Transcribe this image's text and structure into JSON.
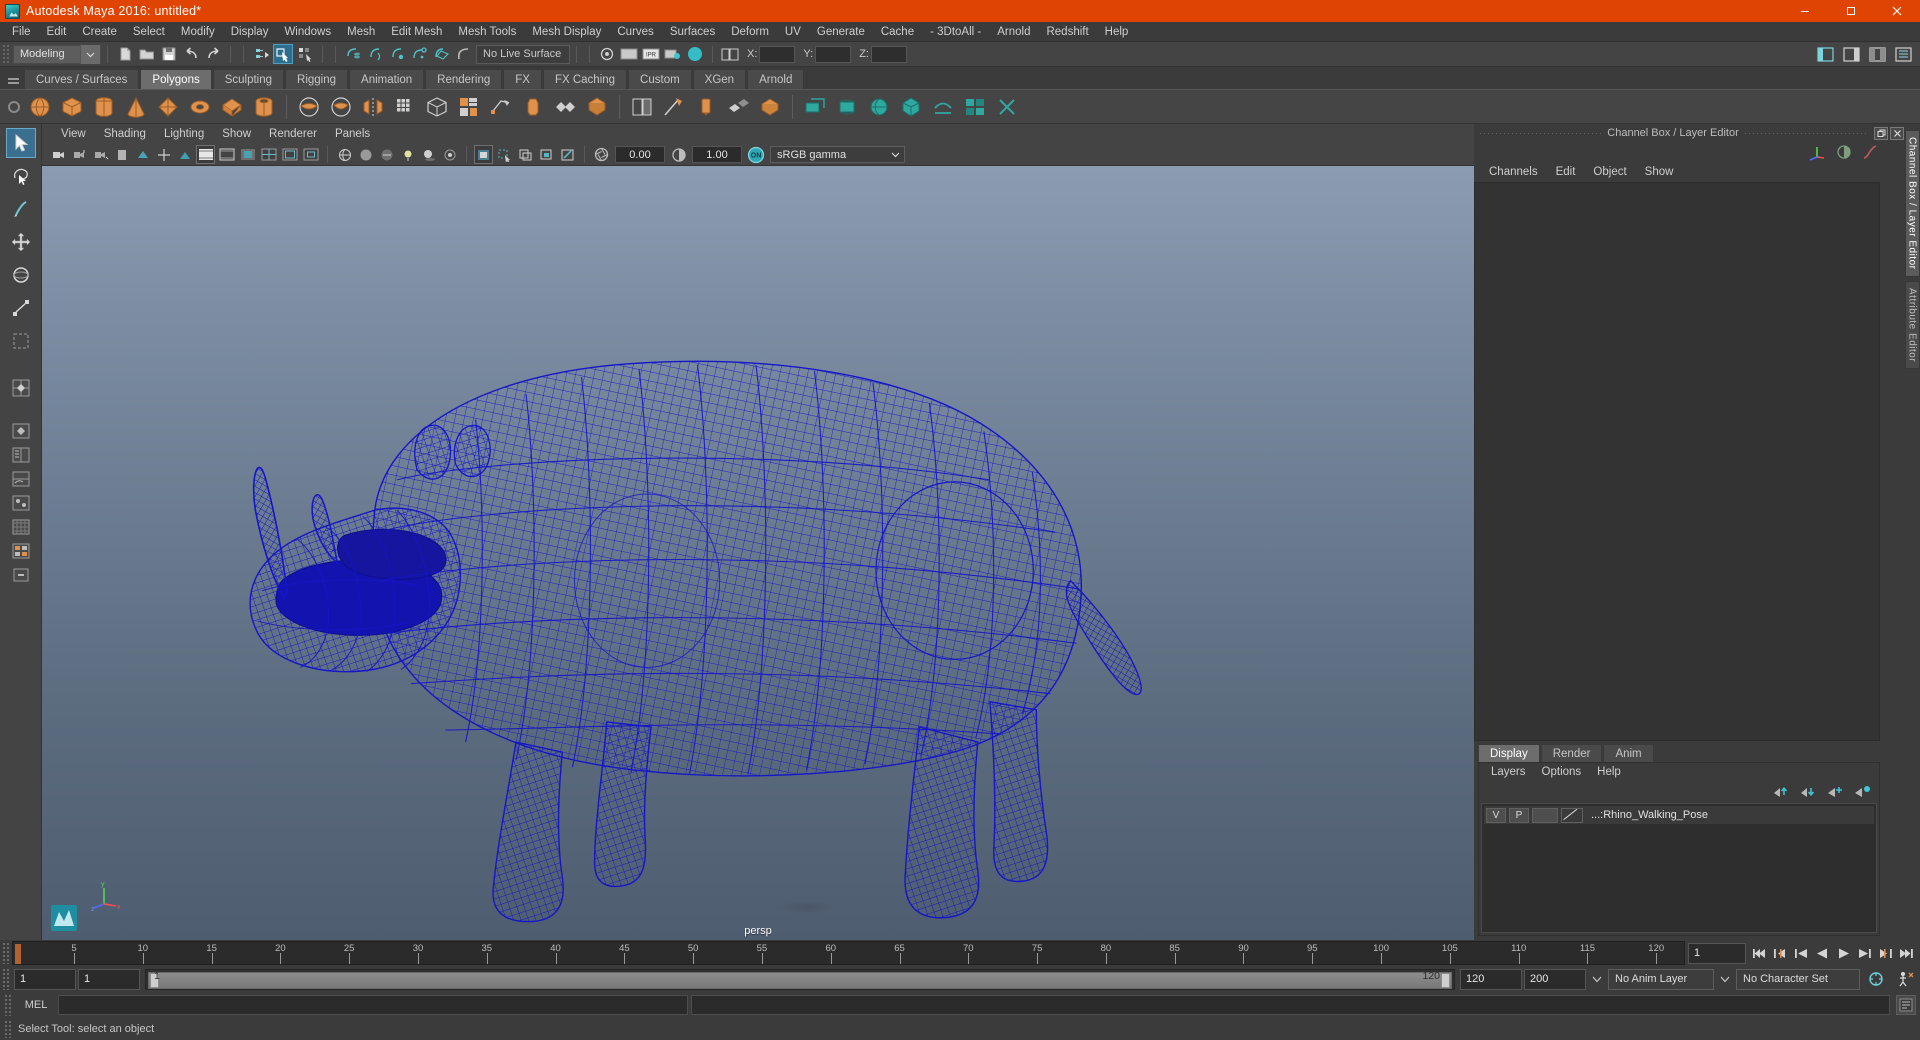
{
  "window": {
    "title": "Autodesk Maya 2016: untitled*",
    "logo_icon": "maya-logo-icon",
    "minimize_icon": "minimize-icon",
    "maximize_icon": "maximize-icon",
    "close_icon": "close-icon"
  },
  "menubar": {
    "items": [
      {
        "label": "File"
      },
      {
        "label": "Edit"
      },
      {
        "label": "Create"
      },
      {
        "label": "Select"
      },
      {
        "label": "Modify"
      },
      {
        "label": "Display"
      },
      {
        "label": "Windows"
      },
      {
        "label": "Mesh"
      },
      {
        "label": "Edit Mesh"
      },
      {
        "label": "Mesh Tools"
      },
      {
        "label": "Mesh Display"
      },
      {
        "label": "Curves"
      },
      {
        "label": "Surfaces"
      },
      {
        "label": "Deform"
      },
      {
        "label": "UV"
      },
      {
        "label": "Generate"
      },
      {
        "label": "Cache"
      },
      {
        "label": "- 3DtoAll -"
      },
      {
        "label": "Arnold"
      },
      {
        "label": "Redshift"
      },
      {
        "label": "Help"
      }
    ]
  },
  "toolbar": {
    "mode": "Modeling",
    "mode_dropdown_icon": "chevron-down-icon",
    "new_scene_icon": "new-file-icon",
    "open_scene_icon": "open-folder-icon",
    "save_scene_icon": "save-disk-icon",
    "undo_icon": "undo-arrow-icon",
    "redo_icon": "redo-arrow-icon",
    "select_hierarchy_icon": "select-by-hierarchy-icon",
    "select_object_icon": "select-by-object-type-icon",
    "select_component_icon": "select-by-component-type-icon",
    "snap_grid_icon": "snap-to-grid-icon",
    "snap_curve_icon": "snap-to-curve-icon",
    "snap_point_icon": "snap-to-point-icon",
    "snap_projected_icon": "snap-to-projected-center-icon",
    "snap_view_plane_icon": "snap-to-view-plane-icon",
    "make_live_icon": "make-live-icon",
    "live_surface_value": "No Live Surface",
    "x_label": "X:",
    "y_label": "Y:",
    "z_label": "Z:",
    "x_value": "",
    "y_value": "",
    "z_value": "",
    "render_icon": "render-current-frame-icon",
    "ipr_icon": "ipr-render-icon",
    "render_settings_icon": "render-settings-icon",
    "hypershade_icon": "hypershade-icon",
    "right_icons": [
      {
        "name": "show-hide-ui-icon"
      },
      {
        "name": "sidebar-attribute-editor-icon"
      },
      {
        "name": "sidebar-tool-settings-icon"
      },
      {
        "name": "sidebar-channel-box-icon"
      }
    ]
  },
  "shelf": {
    "handle_icon": "shelf-handle-icon",
    "tabs": [
      {
        "label": "Curves / Surfaces",
        "active": false
      },
      {
        "label": "Polygons",
        "active": true
      },
      {
        "label": "Sculpting",
        "active": false
      },
      {
        "label": "Rigging",
        "active": false
      },
      {
        "label": "Animation",
        "active": false
      },
      {
        "label": "Rendering",
        "active": false
      },
      {
        "label": "FX",
        "active": false
      },
      {
        "label": "FX Caching",
        "active": false
      },
      {
        "label": "Custom",
        "active": false
      },
      {
        "label": "XGen",
        "active": false
      },
      {
        "label": "Arnold",
        "active": false
      }
    ],
    "buttons": [
      {
        "name": "poly-sphere-icon",
        "color": "#e0924c"
      },
      {
        "name": "poly-cube-icon",
        "color": "#e0924c"
      },
      {
        "name": "poly-cylinder-icon",
        "color": "#e0924c"
      },
      {
        "name": "poly-cone-icon",
        "color": "#e0924c"
      },
      {
        "name": "poly-pyramid-icon",
        "color": "#e0924c"
      },
      {
        "name": "poly-torus-icon",
        "color": "#e0924c"
      },
      {
        "name": "poly-prism-icon",
        "color": "#e0924c"
      },
      {
        "name": "poly-pipe-icon",
        "color": "#e0924c"
      },
      {
        "name": "poly-boolean-union-icon",
        "color": "#cfcfcf"
      },
      {
        "name": "poly-boolean-difference-icon",
        "color": "#cfcfcf"
      },
      {
        "name": "poly-mirror-icon",
        "color": "#e0924c"
      },
      {
        "name": "poly-smooth-icon",
        "color": "#cfcfcf"
      },
      {
        "name": "poly-reduce-icon",
        "color": "#cfcfcf"
      },
      {
        "name": "poly-combine-icon",
        "color": "#e0924c"
      },
      {
        "name": "poly-extract-icon",
        "color": "#e0924c"
      },
      {
        "name": "poly-bevel-icon",
        "color": "#cfcfcf"
      },
      {
        "name": "poly-extrude-icon",
        "color": "#e0924c"
      },
      {
        "name": "poly-bridge-icon",
        "color": "#cfcfcf"
      },
      {
        "name": "poly-append-icon",
        "color": "#cfcfcf"
      },
      {
        "name": "poly-multicut-icon",
        "color": "#cfcfcf"
      },
      {
        "name": "poly-target-weld-icon",
        "color": "#cfcfcf"
      },
      {
        "name": "poly-quad-draw-icon",
        "color": "#cfcfcf"
      },
      {
        "name": "uv-planar-icon",
        "color": "#2aa8a0"
      },
      {
        "name": "uv-cylindrical-icon",
        "color": "#2aa8a0"
      },
      {
        "name": "uv-spherical-icon",
        "color": "#2aa8a0"
      },
      {
        "name": "uv-automatic-icon",
        "color": "#2aa8a0"
      },
      {
        "name": "uv-unfold-icon",
        "color": "#2aa8a0"
      },
      {
        "name": "uv-layout-icon",
        "color": "#2aa8a0"
      },
      {
        "name": "uv-cut-icon",
        "color": "#2aa8a0"
      }
    ]
  },
  "tool_column": {
    "buttons": [
      {
        "name": "select-tool-icon",
        "active": true
      },
      {
        "name": "lasso-select-tool-icon",
        "active": false
      },
      {
        "name": "paint-select-tool-icon",
        "active": false
      },
      {
        "name": "move-tool-icon",
        "active": false
      },
      {
        "name": "rotate-tool-icon",
        "active": false
      },
      {
        "name": "scale-tool-icon",
        "active": false
      },
      {
        "name": "last-tool-used-icon",
        "active": false
      },
      {
        "name": "layout-single-perspective-icon",
        "active": false
      },
      {
        "name": "layout-four-view-icon",
        "active": false
      },
      {
        "name": "layout-persp-outliner-icon",
        "active": false
      },
      {
        "name": "layout-persp-graph-icon",
        "active": false
      },
      {
        "name": "layout-hypershade-icon",
        "active": false
      },
      {
        "name": "layout-uv-editor-icon",
        "active": false
      },
      {
        "name": "layout-custom-icon",
        "active": false
      },
      {
        "name": "layout-more-icon",
        "active": false
      }
    ]
  },
  "panel": {
    "menus": [
      {
        "label": "View"
      },
      {
        "label": "Shading"
      },
      {
        "label": "Lighting"
      },
      {
        "label": "Show"
      },
      {
        "label": "Renderer"
      },
      {
        "label": "Panels"
      }
    ],
    "toolbar_icons": [
      {
        "name": "select-camera-icon"
      },
      {
        "name": "lock-camera-icon"
      },
      {
        "name": "camera-attributes-icon"
      },
      {
        "name": "bookmark-icon"
      },
      {
        "name": "image-plane-icon"
      },
      {
        "name": "two-d-pan-zoom-icon"
      },
      {
        "name": "grid-toggle-icon"
      },
      {
        "name": "film-gate-icon"
      },
      {
        "name": "resolution-gate-icon"
      },
      {
        "name": "gate-mask-icon"
      },
      {
        "name": "field-chart-icon"
      },
      {
        "name": "safe-action-icon"
      },
      {
        "name": "safe-title-icon"
      },
      {
        "name": "wireframe-shading-icon"
      },
      {
        "name": "smooth-shade-all-icon"
      },
      {
        "name": "shaded-and-textured-icon"
      },
      {
        "name": "use-all-lights-icon"
      },
      {
        "name": "shadows-icon"
      },
      {
        "name": "screen-space-ao-icon"
      },
      {
        "name": "motion-blur-icon"
      },
      {
        "name": "multisample-aa-icon"
      },
      {
        "name": "depth-of-field-icon"
      },
      {
        "name": "isolate-select-icon"
      },
      {
        "name": "xray-toggle-icon"
      },
      {
        "name": "xray-joints-icon"
      },
      {
        "name": "xray-active-components-icon"
      },
      {
        "name": "exposure-icon"
      },
      {
        "name": "gamma-icon"
      },
      {
        "name": "view-transform-enabled-icon"
      }
    ],
    "exposure_value": "0.00",
    "gamma_value": "1.00",
    "color_transform": "sRGB gamma",
    "color_transform_arrow_icon": "chevron-down-icon",
    "viewport_label": "persp",
    "axis_x_label": "x",
    "axis_y_label": "y",
    "axis_z_label": "z",
    "maya_badge_icon": "maya-logo-icon",
    "model_name": "rhino-wireframe-model",
    "wireframe_color": "#1616c8",
    "background_top": "#8c9cb0",
    "background_bottom": "#4e5d6f"
  },
  "channel_box": {
    "title": "Channel Box / Layer Editor",
    "restore_icon": "restore-panel-icon",
    "close_icon": "close-panel-icon",
    "header_icons": [
      {
        "name": "channel-box-axis-icon"
      },
      {
        "name": "channel-box-attribute-icon"
      },
      {
        "name": "channel-box-anim-curve-icon"
      }
    ],
    "menus": [
      {
        "label": "Channels"
      },
      {
        "label": "Edit"
      },
      {
        "label": "Object"
      },
      {
        "label": "Show"
      }
    ]
  },
  "layer_editor": {
    "tabs": [
      {
        "label": "Display",
        "active": true
      },
      {
        "label": "Render",
        "active": false
      },
      {
        "label": "Anim",
        "active": false
      }
    ],
    "menus": [
      {
        "label": "Layers"
      },
      {
        "label": "Options"
      },
      {
        "label": "Help"
      }
    ],
    "tool_icons": [
      {
        "name": "move-layer-up-icon"
      },
      {
        "name": "move-layer-down-icon"
      },
      {
        "name": "create-new-layer-icon"
      },
      {
        "name": "create-layer-from-selected-icon"
      }
    ],
    "rows": [
      {
        "visibility": "V",
        "playback": "P",
        "type": "",
        "color_icon": "layer-color-swatch-icon",
        "name": "...:Rhino_Walking_Pose"
      }
    ]
  },
  "right_vertical_tabs": [
    {
      "label": "Channel Box / Layer Editor",
      "active": true
    },
    {
      "label": "Attribute Editor",
      "active": false
    }
  ],
  "timeline": {
    "current_frame": "1",
    "start_label": "1",
    "ticks": [
      5,
      10,
      15,
      20,
      25,
      30,
      35,
      40,
      45,
      50,
      55,
      60,
      65,
      70,
      75,
      80,
      85,
      90,
      95,
      100,
      105,
      110,
      115,
      120
    ],
    "frame_field_value": "1",
    "playback_buttons": [
      {
        "name": "go-to-start-icon"
      },
      {
        "name": "step-back-keyframe-icon"
      },
      {
        "name": "step-back-frame-icon"
      },
      {
        "name": "play-backwards-icon"
      },
      {
        "name": "play-forwards-icon"
      },
      {
        "name": "step-forward-frame-icon"
      },
      {
        "name": "step-forward-keyframe-icon"
      },
      {
        "name": "go-to-end-icon"
      }
    ]
  },
  "range_slider": {
    "anim_start": "1",
    "range_start": "1",
    "range_bar_start": "1",
    "range_bar_end": "120",
    "range_end": "120",
    "anim_end": "200",
    "anim_end_arrow_icon": "chevron-down-icon",
    "anim_layer": "No Anim Layer",
    "anim_layer_arrow_icon": "chevron-down-icon",
    "character_set": "No Character Set",
    "auto_key_icon": "auto-keyframe-toggle-icon",
    "animation_prefs_icon": "animation-preferences-icon"
  },
  "command_line": {
    "language_label": "MEL",
    "input_value": "",
    "output_value": "",
    "script_editor_icon": "script-editor-icon"
  },
  "status_line": {
    "message": "Select Tool: select an object"
  }
}
